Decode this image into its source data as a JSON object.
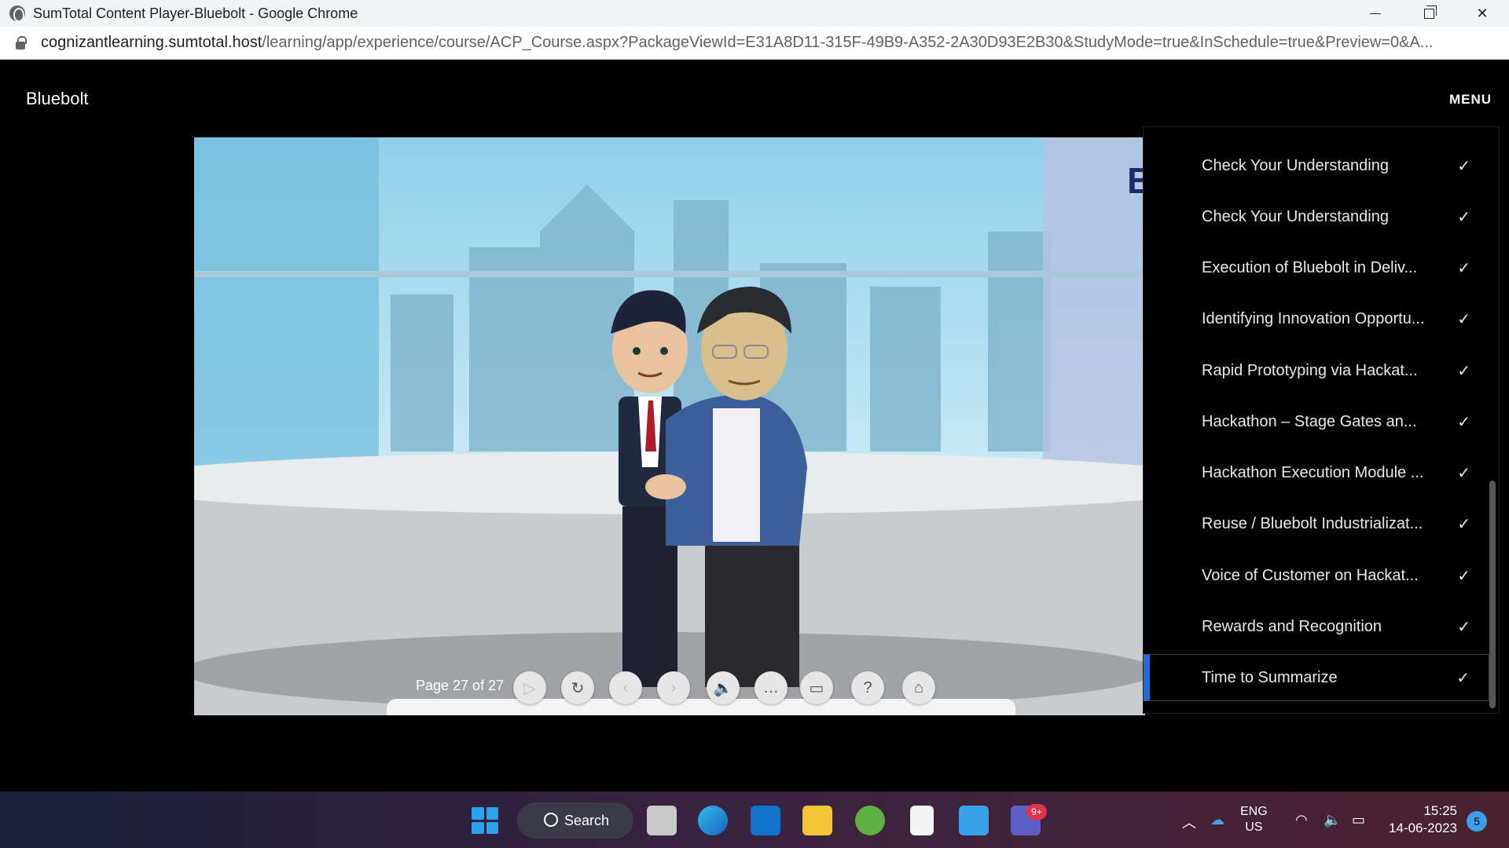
{
  "window": {
    "title": "SumTotal Content Player-Bluebolt - Google Chrome",
    "url_host": "cognizantlearning.sumtotal.host",
    "url_path": "/learning/app/experience/course/ACP_Course.aspx?PackageViewId=E31A8D11-315F-49B9-A352-2A30D93E2B30&StudyMode=true&InSchedule=true&Preview=0&A..."
  },
  "header": {
    "brand": "Bluebolt",
    "menu_label": "MENU"
  },
  "stage": {
    "letter": "B",
    "page_info": "Page 27 of 27"
  },
  "controls": [
    "play-icon",
    "replay-icon",
    "prev-icon",
    "next-icon",
    "volume-icon",
    "captions-icon",
    "folder-icon",
    "help-icon",
    "home-icon"
  ],
  "menu": {
    "items": [
      {
        "label": "Check Your Understanding",
        "check": "✓"
      },
      {
        "label": "Check Your Understanding",
        "check": "✓"
      },
      {
        "label": "Execution of Bluebolt in Deliv...",
        "check": "✓"
      },
      {
        "label": "Identifying Innovation Opportu...",
        "check": "✓"
      },
      {
        "label": "Rapid Prototyping via Hackat...",
        "check": "✓"
      },
      {
        "label": "Hackathon – Stage Gates an...",
        "check": "✓"
      },
      {
        "label": "Hackathon Execution Module ...",
        "check": "✓"
      },
      {
        "label": "Reuse / Bluebolt Industrializat...",
        "check": "✓"
      },
      {
        "label": "Voice of Customer on Hackat...",
        "check": "✓"
      },
      {
        "label": "Rewards and Recognition",
        "check": "✓"
      },
      {
        "label": "Time to Summarize",
        "check": "✓"
      }
    ]
  },
  "taskbar": {
    "search_label": "Search",
    "teams_badge": "9+",
    "lang_top": "ENG",
    "lang_bottom": "US",
    "time": "15:25",
    "date": "14-06-2023",
    "notifications": "5"
  },
  "colors": {
    "accent": "#1f6fd1",
    "taskbar": "#2a2240"
  }
}
